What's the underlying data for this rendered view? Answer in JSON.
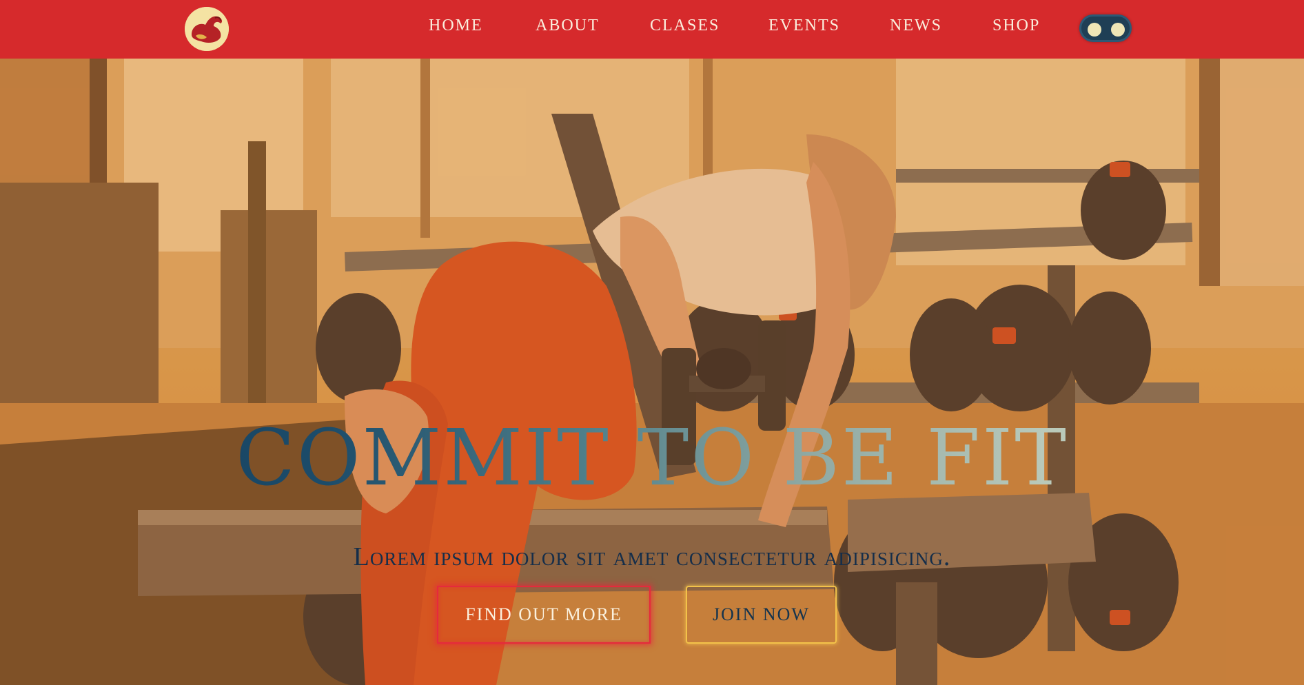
{
  "header": {
    "logo_icon": "flexed-arm-icon",
    "nav": [
      {
        "label": "HOME"
      },
      {
        "label": "ABOUT"
      },
      {
        "label": "CLASES"
      },
      {
        "label": "EVENTS"
      },
      {
        "label": "NEWS"
      },
      {
        "label": "SHOP"
      }
    ],
    "theme_toggle_icon": "theme-toggle-icon"
  },
  "hero": {
    "title": "COMMIT TO BE FIT",
    "subtitle": "Lorem ipsum dolor sit amet consectetur adipisicing.",
    "buttons": {
      "find_out_more": "FIND OUT MORE",
      "join_now": "JOIN NOW"
    },
    "background_image": "woman-lifting-dumbbell-in-gym"
  },
  "colors": {
    "header_bg": "#d62a2c",
    "nav_text": "#fbeedd",
    "hero_tint": "#d99a52",
    "title_gradient_start": "#143a58",
    "title_gradient_end": "#c9d6c4",
    "subtitle": "#152e4a",
    "find_out_more_border": "#e52a3c",
    "join_now_border": "#f3c24a"
  }
}
